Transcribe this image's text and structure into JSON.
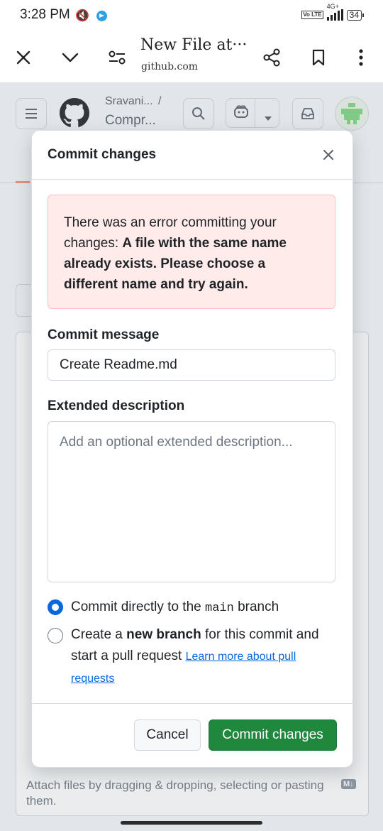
{
  "status_bar": {
    "time": "3:28 PM",
    "network": "4G+",
    "volte": "Vo LTE",
    "battery": "34"
  },
  "browser": {
    "title": "New File at···",
    "url": "github.com"
  },
  "github_header": {
    "breadcrumb_owner": "Sravani...",
    "breadcrumb_sep": "/",
    "breadcrumb_repo": "Compr..."
  },
  "background": {
    "attach_hint": "Attach files by dragging & dropping, selecting or pasting them.",
    "markdown_badge": "M↓"
  },
  "modal": {
    "title": "Commit changes",
    "error_prefix": "There was an error committing your changes: ",
    "error_bold": "A file with the same name already exists. Please choose a different name and try again.",
    "commit_message_label": "Commit message",
    "commit_message_value": "Create Readme.md",
    "extended_label": "Extended description",
    "extended_placeholder": "Add an optional extended description...",
    "option1_prefix": "Commit directly to the ",
    "option1_branch": "main",
    "option1_suffix": " branch",
    "option2_prefix": "Create a ",
    "option2_bold": "new branch",
    "option2_suffix": " for this commit and start a pull request ",
    "option2_link": "Learn more about pull requests",
    "selected_option": 1,
    "cancel_label": "Cancel",
    "commit_label": "Commit changes"
  },
  "colors": {
    "primary": "#1f883d",
    "link": "#0969da",
    "radio_selected": "#0969da",
    "error_bg": "#ffebe9"
  }
}
